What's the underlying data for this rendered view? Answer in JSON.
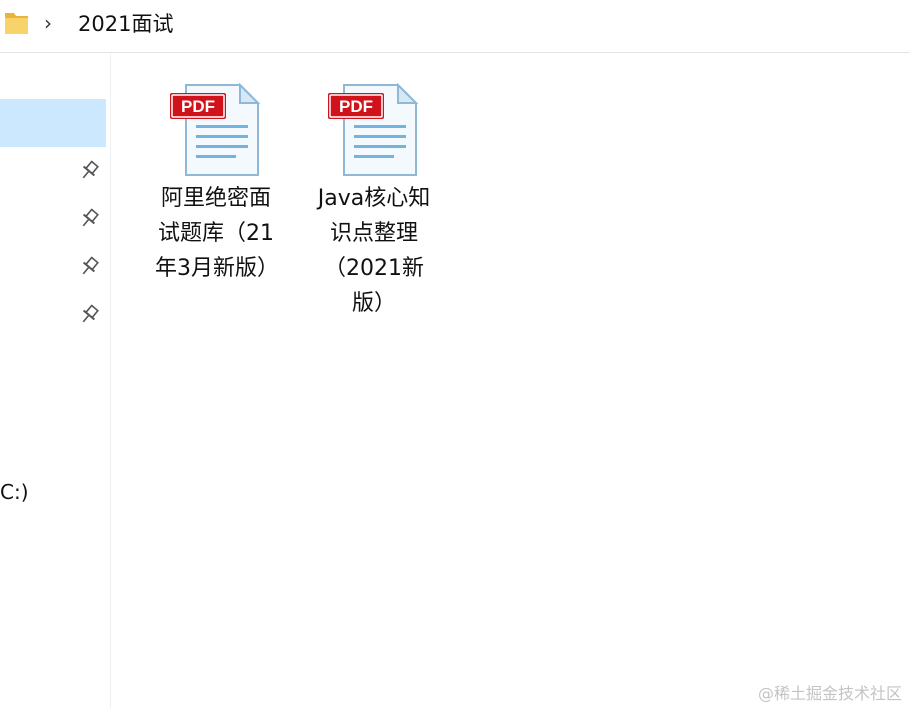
{
  "address_bar": {
    "breadcrumb": "2021面试"
  },
  "nav": {
    "drive_label": "C:)"
  },
  "files": [
    {
      "name": "阿里绝密面试题库（21年3月新版）",
      "type_badge": "PDF"
    },
    {
      "name": "Java核心知识点整理（2021新版）",
      "type_badge": "PDF"
    }
  ],
  "watermark": "@稀土掘金技术社区",
  "colors": {
    "selection": "#cce8ff",
    "pdf_badge": "#d0121b",
    "folder": "#f4c64a"
  }
}
